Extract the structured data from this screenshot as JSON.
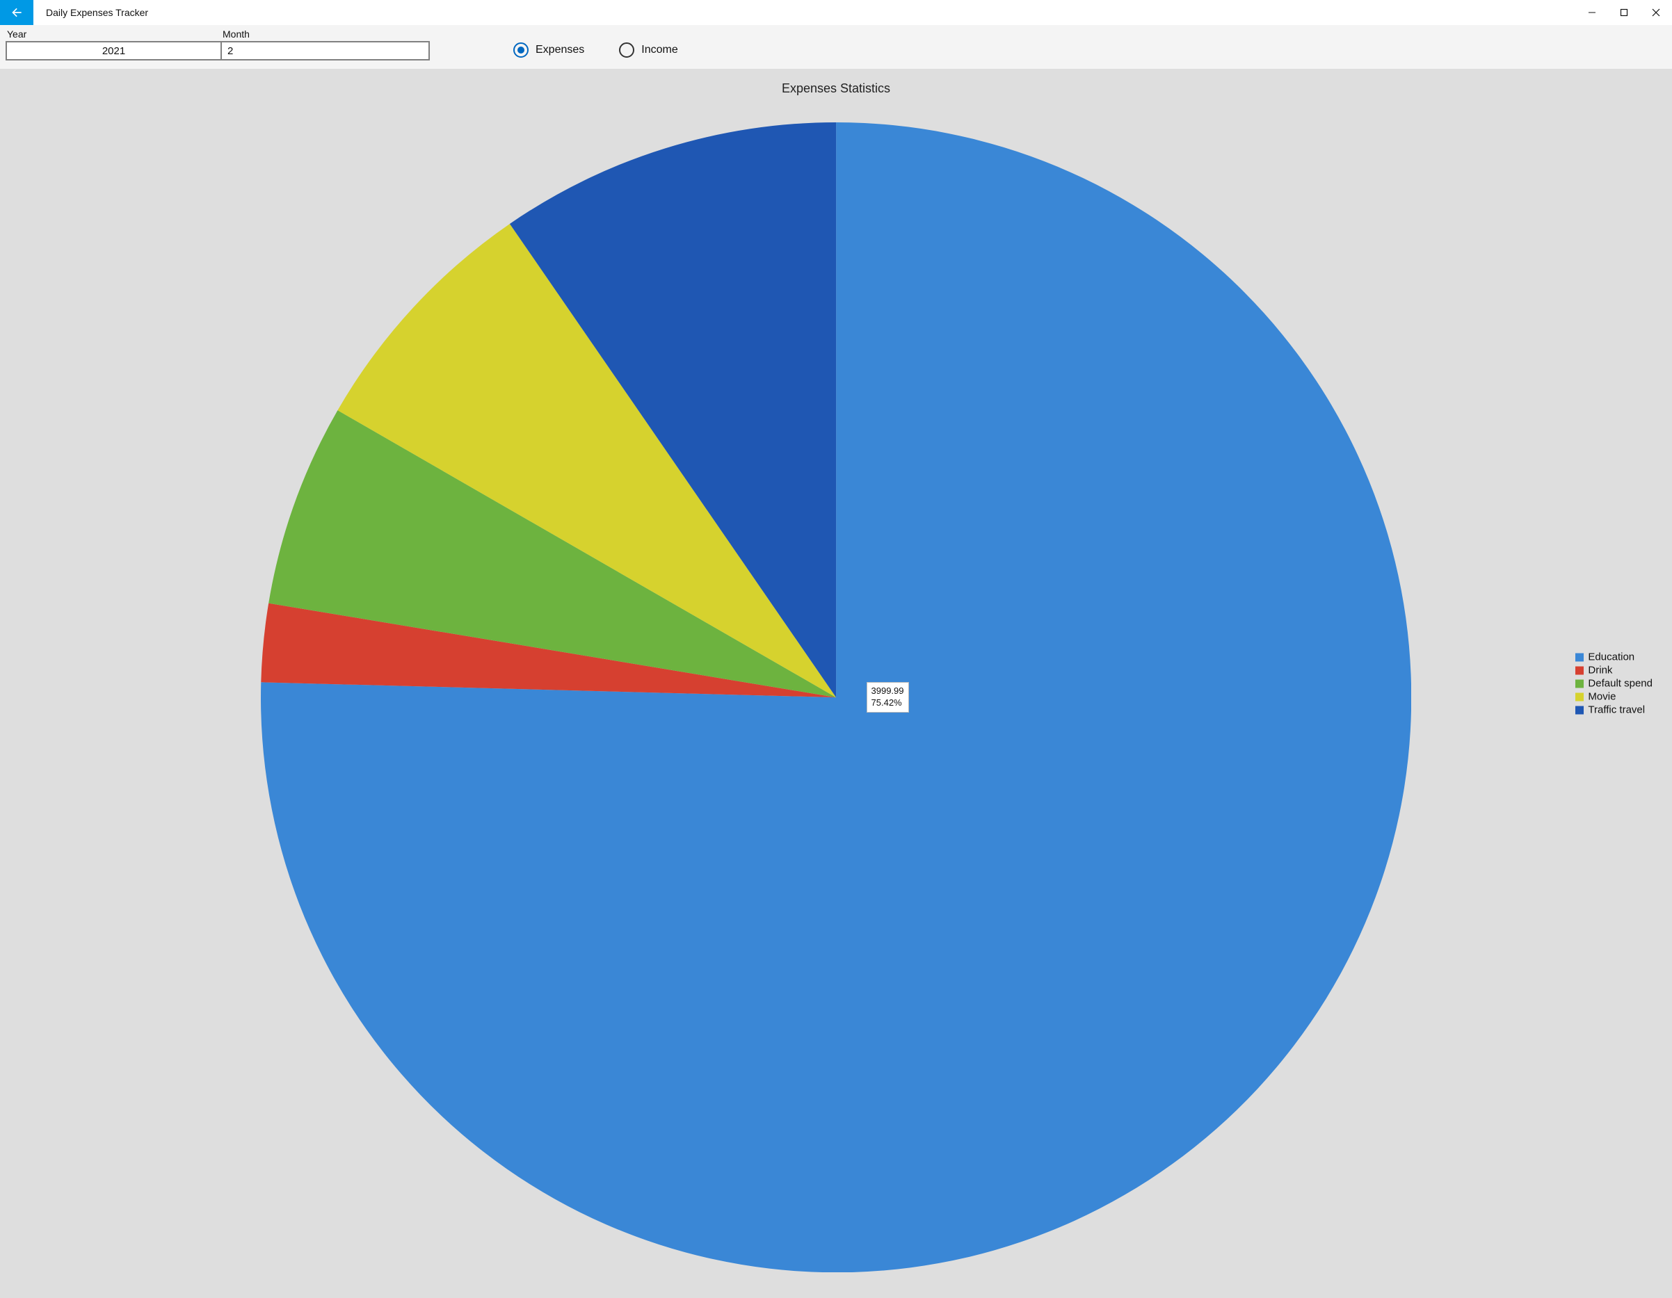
{
  "titlebar": {
    "title": "Daily Expenses Tracker"
  },
  "controls": {
    "year_label": "Year",
    "month_label": "Month",
    "year_value": "2021",
    "month_value": "2",
    "radio_expenses_label": "Expenses",
    "radio_income_label": "Income",
    "selected_radio": "expenses"
  },
  "chart_title": "Expenses Statistics",
  "tooltip": {
    "value_text": "3999.99",
    "pct_text": "75.42%"
  },
  "legend": [
    {
      "label": "Education",
      "color": "#3a87d6"
    },
    {
      "label": "Drink",
      "color": "#d64030"
    },
    {
      "label": "Default spend",
      "color": "#6db33f"
    },
    {
      "label": "Movie",
      "color": "#d6d22e"
    },
    {
      "label": "Traffic travel",
      "color": "#1f57b3"
    }
  ],
  "chart_data": {
    "type": "pie",
    "title": "Expenses Statistics",
    "series": [
      {
        "name": "Education",
        "value": 3999.99,
        "pct": 75.42,
        "color": "#3a87d6"
      },
      {
        "name": "Drink",
        "value": 116.73,
        "pct": 2.2,
        "color": "#d64030"
      },
      {
        "name": "Default spend",
        "value": 302.37,
        "pct": 5.7,
        "color": "#6db33f"
      },
      {
        "name": "Movie",
        "value": 375.6,
        "pct": 7.08,
        "color": "#d6d22e"
      },
      {
        "name": "Traffic travel",
        "value": 509.02,
        "pct": 9.6,
        "color": "#1f57b3"
      }
    ]
  }
}
